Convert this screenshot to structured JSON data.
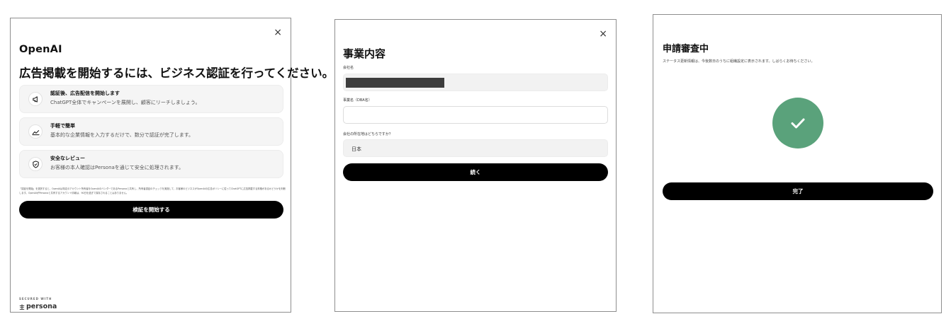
{
  "panel1": {
    "close": "×",
    "brand": "OpenAI",
    "headline": "広告掲載を開始するには、ビジネス認証を行ってください。",
    "features": [
      {
        "icon": "megaphone-icon",
        "title": "認証後、広告配信を開始します",
        "desc": "ChatGPT全体でキャンペーンを展開し、顧客にリーチしましょう。"
      },
      {
        "icon": "trend-chart-icon",
        "title": "手軽で簡単",
        "desc": "基本的な企業情報を入力するだけで、数分で認証が完了します。"
      },
      {
        "icon": "shield-check-icon",
        "title": "安全なレビュー",
        "desc": "お客様の本人確認はPersonaを通じて安全に処理されます。"
      }
    ],
    "disclaimer": "「認証を開始」を選択すると、OpenAIは特定のアカウント所有者をOpenAIのベンダーであるPersonaと共有し、所有者認証のチェックを実施して、お客様のビジネスがOpenAIの広告ポリシーに従ってChatGPTに広告掲載する資格があるかどうかを判断します。OpenAIがPersonaと共有するアカウント情報は、90日を過ぎて保存されることはありません。",
    "button": "検証を開始する",
    "secured_with": "SECURED WITH",
    "persona": "persona"
  },
  "panel2": {
    "close": "×",
    "title": "事業内容",
    "company_label": "会社名",
    "dba_label": "事業名（DBA名）",
    "country_label": "会社の所在地はどちらですか？",
    "country_value": "日本",
    "button": "続く"
  },
  "panel3": {
    "title": "申請審査中",
    "subtitle": "ステータス更新情報は、今後数日のうちに組織設定に表示されます。しばらくお待ちください。",
    "button": "完了"
  },
  "colors": {
    "accent": "#5aa27b",
    "button": "#000000"
  }
}
